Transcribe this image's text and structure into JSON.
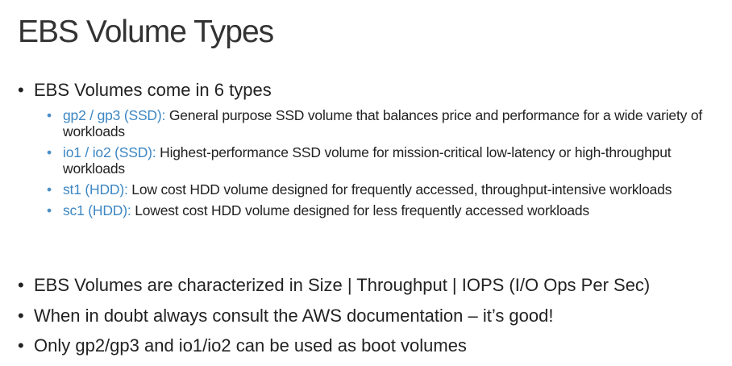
{
  "title": "EBS Volume Types",
  "bullets": {
    "b1": "EBS Volumes come in 6 types",
    "b2": "EBS Volumes are characterized in Size | Throughput | IOPS (I/O Ops Per Sec)",
    "b3": "When in doubt always consult the AWS documentation – it’s good!",
    "b4": "Only gp2/gp3 and io1/io2 can be used as boot volumes"
  },
  "volume_types": [
    {
      "name": "gp2 / gp3 (SSD):",
      "description": " General purpose SSD volume that balances price and performance for a wide variety of workloads"
    },
    {
      "name": "io1 / io2 (SSD):",
      "description": " Highest-performance SSD volume for mission-critical low-latency or high-throughput workloads"
    },
    {
      "name": "st1 (HDD):",
      "description": " Low cost HDD volume designed for frequently accessed, throughput-intensive workloads"
    },
    {
      "name": "sc1 (HDD):",
      "description": " Lowest cost HDD volume designed for less frequently accessed workloads"
    }
  ],
  "colors": {
    "accent": "#3d87c4",
    "text": "#222222",
    "title": "#333333"
  }
}
